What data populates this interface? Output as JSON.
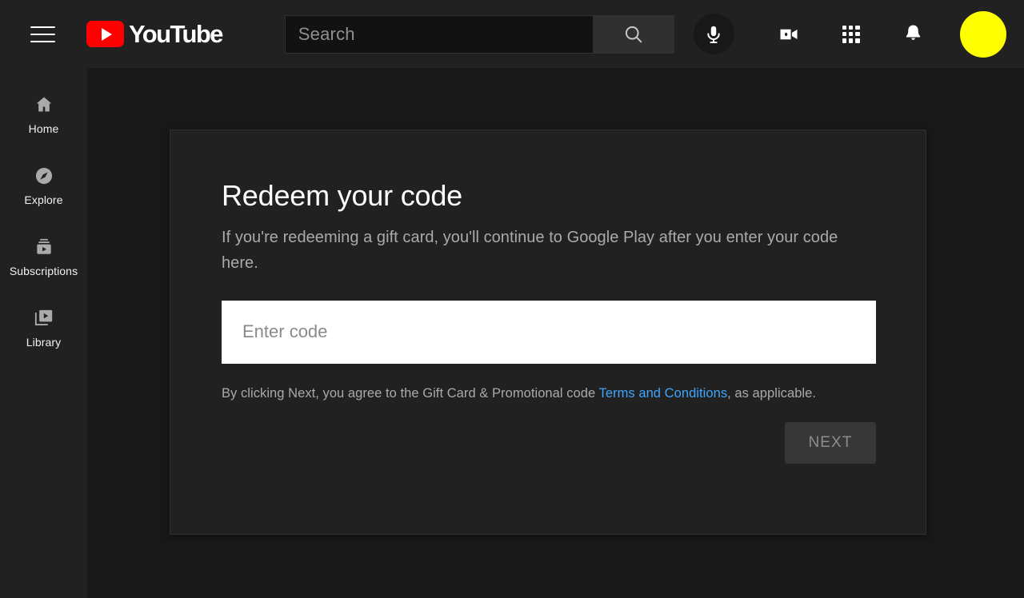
{
  "header": {
    "menu_icon": "hamburger-menu-icon",
    "logo": {
      "wordmark": "YouTube",
      "play_icon": "youtube-play-icon",
      "brand_color": "#ff0000"
    },
    "search": {
      "placeholder": "Search",
      "value": "",
      "search_icon": "magnifier-icon",
      "voice_icon": "microphone-icon"
    },
    "icons": [
      {
        "name": "create-video-icon",
        "label": "Create"
      },
      {
        "name": "apps-grid-icon",
        "label": "YouTube apps"
      },
      {
        "name": "notifications-bell-icon",
        "label": "Notifications"
      }
    ],
    "avatar": {
      "name": "account-avatar",
      "color": "#ffff00"
    }
  },
  "sidebar": {
    "items": [
      {
        "label": "Home",
        "icon": "home-icon"
      },
      {
        "label": "Explore",
        "icon": "compass-icon"
      },
      {
        "label": "Subscriptions",
        "icon": "subscriptions-icon"
      },
      {
        "label": "Library",
        "icon": "library-icon"
      }
    ]
  },
  "main": {
    "card": {
      "title": "Redeem your code",
      "description": "If you're redeeming a gift card, you'll continue to Google Play after you enter your code here.",
      "input": {
        "placeholder": "Enter code",
        "value": ""
      },
      "terms": {
        "prefix": "By clicking Next, you agree to the Gift Card & Promotional code ",
        "link": "Terms and Conditions",
        "suffix": ", as applicable."
      },
      "next_label": "NEXT"
    }
  },
  "colors": {
    "page_background": "#181818",
    "chrome_background": "#212121",
    "link": "#3ea6ff",
    "accent": "#ff0000",
    "input_background": "#ffffff"
  }
}
